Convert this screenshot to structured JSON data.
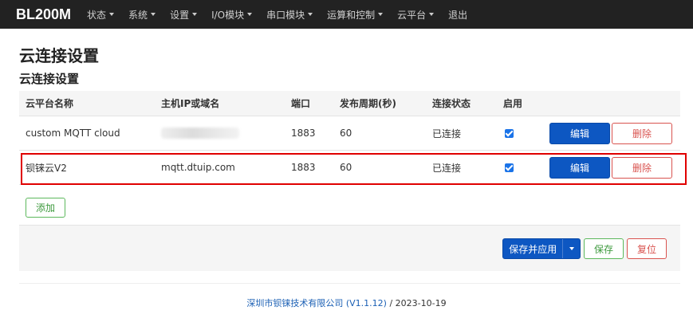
{
  "navbar": {
    "brand": "BL200M",
    "items": [
      {
        "label": "状态",
        "dropdown": true
      },
      {
        "label": "系统",
        "dropdown": true
      },
      {
        "label": "设置",
        "dropdown": true
      },
      {
        "label": "I/O模块",
        "dropdown": true
      },
      {
        "label": "串口模块",
        "dropdown": true
      },
      {
        "label": "运算和控制",
        "dropdown": true
      },
      {
        "label": "云平台",
        "dropdown": true
      },
      {
        "label": "退出",
        "dropdown": false
      }
    ]
  },
  "page": {
    "title": "云连接设置",
    "section_title": "云连接设置"
  },
  "table": {
    "headers": [
      "云平台名称",
      "主机IP或域名",
      "端口",
      "发布周期(秒)",
      "连接状态",
      "启用"
    ],
    "rows": [
      {
        "name": "custom MQTT cloud",
        "host": "",
        "host_obscured": true,
        "port": "1883",
        "period": "60",
        "status": "已连接",
        "enabled": true,
        "edit": "编辑",
        "delete": "删除"
      },
      {
        "name": "钡铼云V2",
        "host": "mqtt.dtuip.com",
        "host_obscured": false,
        "port": "1883",
        "period": "60",
        "status": "已连接",
        "enabled": true,
        "edit": "编辑",
        "delete": "删除"
      }
    ]
  },
  "add_button": "添加",
  "actions": {
    "save_apply": "保存并应用",
    "save": "保存",
    "reset": "复位"
  },
  "footer": {
    "link": "深圳市钡铼技术有限公司 (V1.1.12)",
    "date": " / 2023-10-19"
  },
  "colors": {
    "navbar_bg": "#222222",
    "primary": "#0d57c2",
    "success": "#5cb85c",
    "danger": "#d9534f",
    "highlight": "#e00000"
  }
}
